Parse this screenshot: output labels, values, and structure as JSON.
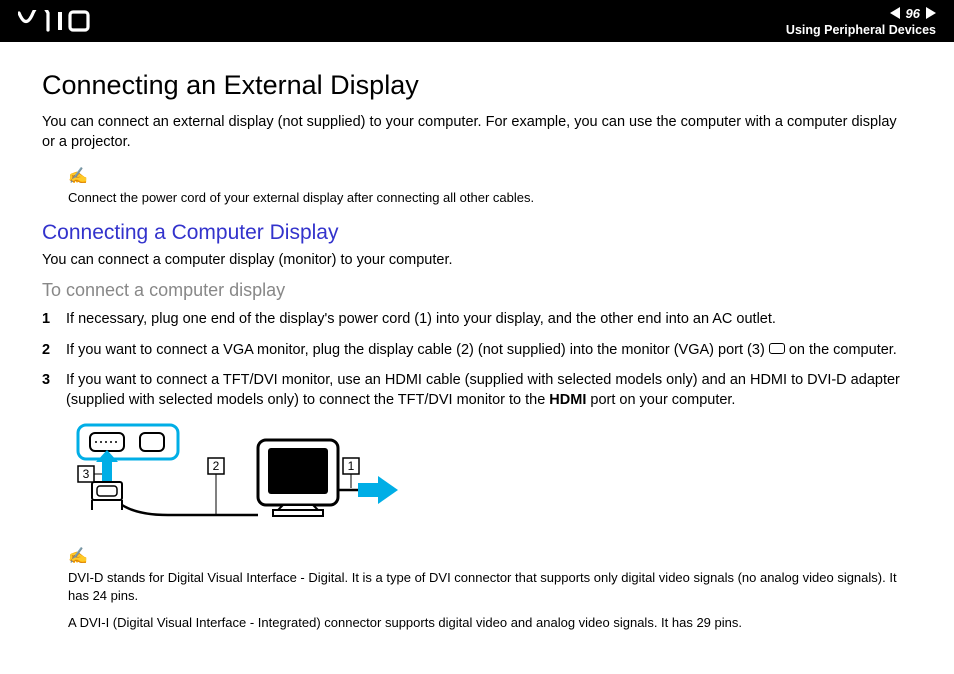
{
  "header": {
    "page_number": "96",
    "section": "Using Peripheral Devices"
  },
  "title": "Connecting an External Display",
  "intro": "You can connect an external display (not supplied) to your computer. For example, you can use the computer with a computer display or a projector.",
  "note1": "Connect the power cord of your external display after connecting all other cables.",
  "sub_title": "Connecting a Computer Display",
  "sub_intro": "You can connect a computer display (monitor) to your computer.",
  "procedure_title": "To connect a computer display",
  "steps": [
    "If necessary, plug one end of the display's power cord (1) into your display, and the other end into an AC outlet.",
    "If you want to connect a VGA monitor, plug the display cable (2) (not supplied) into the monitor (VGA) port (3) ⬚ on the computer.",
    "If you want to connect a TFT/DVI monitor, use an HDMI cable (supplied with selected models only) and an HDMI to DVI-D adapter (supplied with selected models only) to connect the TFT/DVI monitor to the "
  ],
  "step3_bold": "HDMI",
  "step3_tail": " port on your computer.",
  "note2a": "DVI-D stands for Digital Visual Interface - Digital. It is a type of DVI connector that supports only digital video signals (no analog video signals). It has 24 pins.",
  "note2b": "A DVI-I (Digital Visual Interface - Integrated) connector supports digital video and analog video signals. It has 29 pins.",
  "diagram_labels": {
    "l1": "1",
    "l2": "2",
    "l3": "3"
  }
}
